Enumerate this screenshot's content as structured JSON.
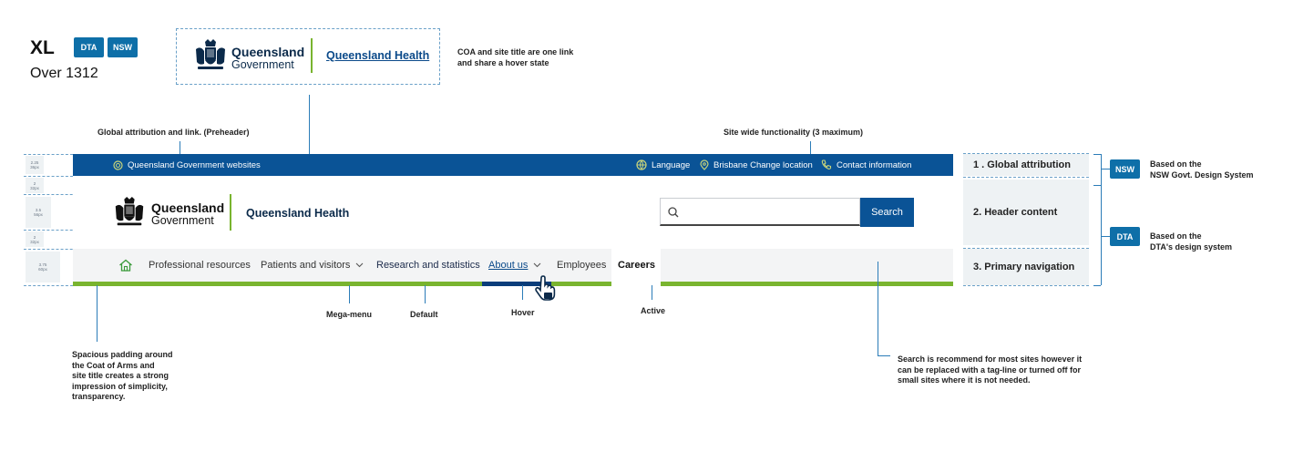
{
  "breakpoint": {
    "size": "XL",
    "range": "Over 1312"
  },
  "badges": {
    "dta": "DTA",
    "nsw": "NSW"
  },
  "logo_example": {
    "line1": "Queensland",
    "line2": "Government",
    "site_title": "Queensland Health"
  },
  "notes": {
    "coa_title_line1": "COA and site title are one link",
    "coa_title_line2": "and share a hover state",
    "global_attribution": "Global attribution and link.  (Preheader)",
    "site_wide": "Site wide functionality (3 maximum)",
    "mega_menu": "Mega-menu",
    "default": "Default",
    "hover": "Hover",
    "active": "Active",
    "padding": [
      "Spacious padding around",
      "the Coat of Arms and",
      "site title creates a strong",
      "impression of simplicity,",
      "transparency."
    ],
    "search": [
      "Search is recommend for most sites however it",
      "can be replaced with a tag-line or turned off for",
      "small sites where it is not needed."
    ]
  },
  "spacers": [
    {
      "a": "2.25",
      "b": "36px"
    },
    {
      "a": "2",
      "b": "32px"
    },
    {
      "a": "3.5",
      "b": "56px"
    },
    {
      "a": "2",
      "b": "32px"
    },
    {
      "a": "3.75",
      "b": "60px"
    }
  ],
  "preheader": {
    "attribution": "Queensland Government websites",
    "language": "Language",
    "location": "Brisbane Change location",
    "contact": "Contact information"
  },
  "header": {
    "line1": "Queensland",
    "line2": "Government",
    "site_title": "Queensland Health",
    "search_placeholder": "",
    "search_button": "Search"
  },
  "nav": {
    "items": [
      "Professional resources",
      "Patients and visitors",
      "Research and statistics",
      "About us",
      "Employees",
      "Careers"
    ]
  },
  "sections": {
    "global": "1 . Global attribution",
    "header": "2. Header content",
    "primary": "3. Primary navigation"
  },
  "systems": {
    "nsw_badge": "NSW",
    "nsw_line1": "Based on the",
    "nsw_line2": "NSW Govt. Design System",
    "dta_badge": "DTA",
    "dta_line1": "Based on the",
    "dta_line2": "DTA's design system"
  },
  "colors": {
    "preheader": "#0a5396",
    "accent_green": "#79b42f",
    "active_blue": "#0a3d7a",
    "badge": "#0e6fa8"
  },
  "icons": [
    "home-icon",
    "search-icon",
    "globe-icon",
    "location-pin-icon",
    "phone-icon",
    "chevron-down-icon",
    "hand-pointer-icon",
    "coat-of-arms-icon"
  ]
}
